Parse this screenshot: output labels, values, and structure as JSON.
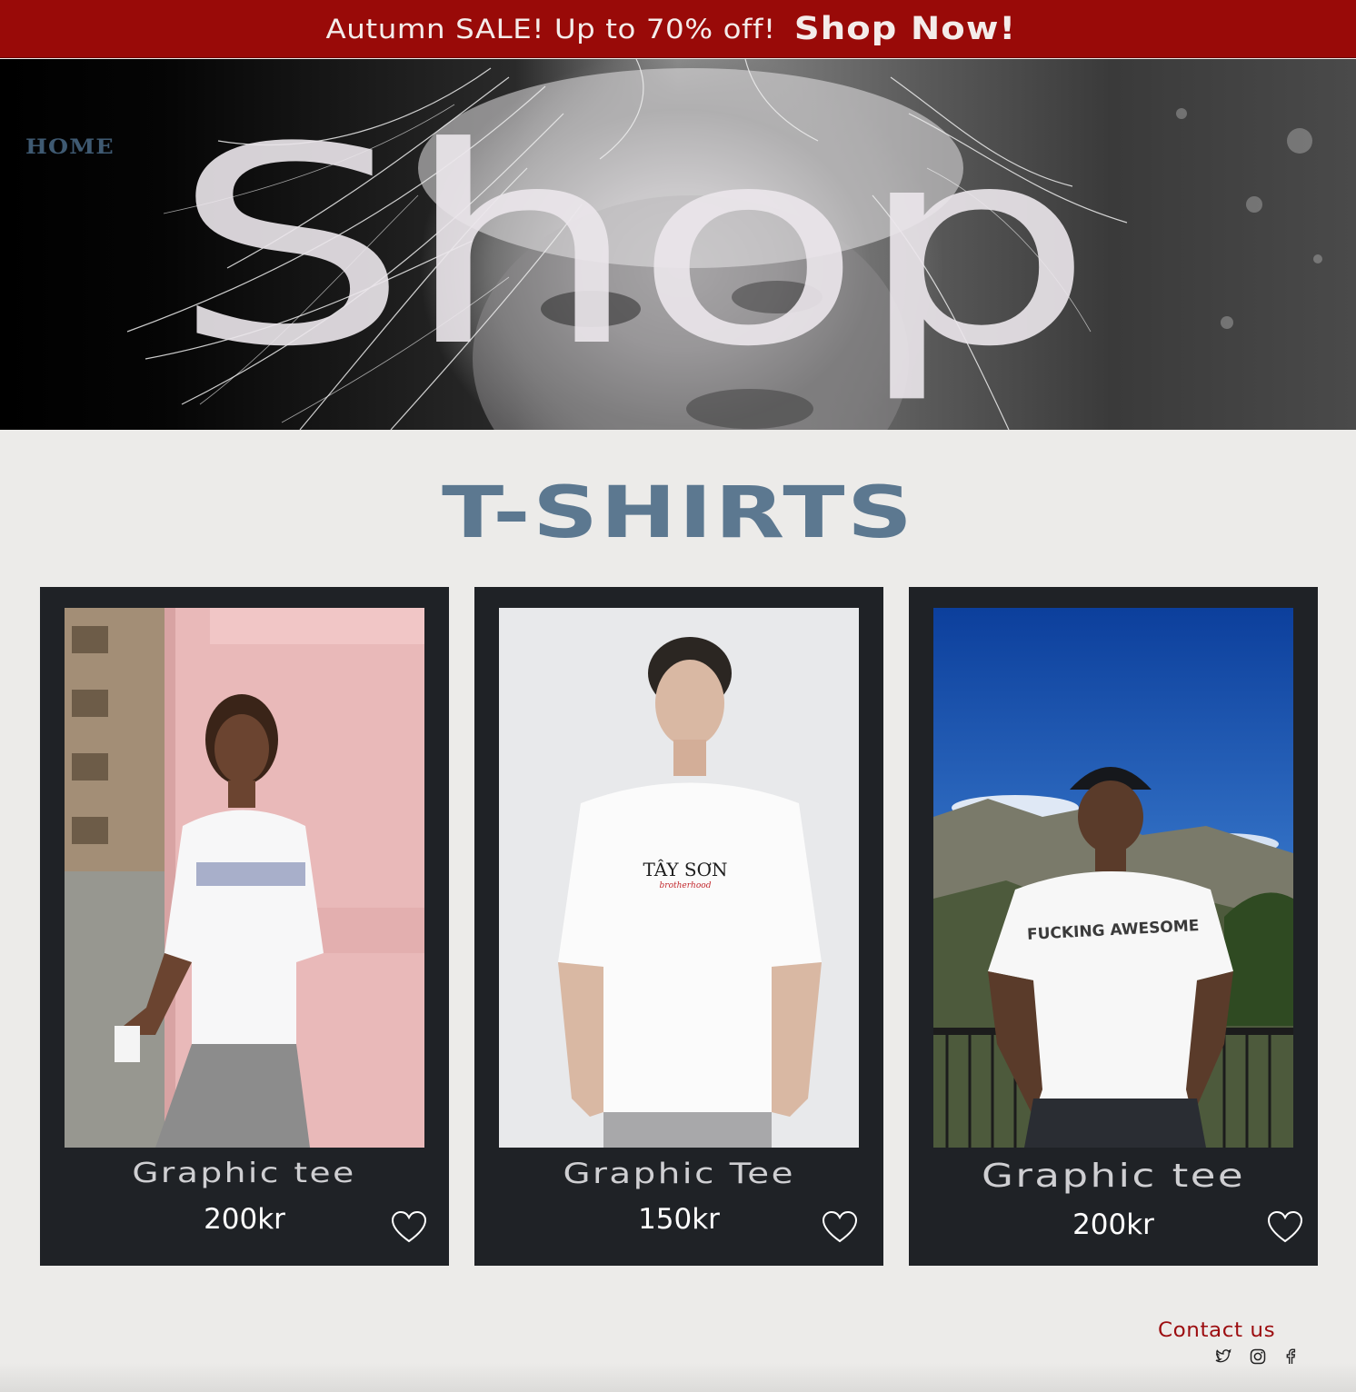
{
  "banner": {
    "sale_text": "Autumn SALE! Up to 70% off!",
    "cta_label": "Shop Now!",
    "background_color": "#990a08"
  },
  "hero": {
    "word": "Shop",
    "home_label": "HOME"
  },
  "section": {
    "title": "T-SHIRTS",
    "title_color": "#5c7890"
  },
  "products": [
    {
      "name": "Graphic tee",
      "price": "200kr",
      "favorite_icon": "heart-icon"
    },
    {
      "name": "Graphic Tee",
      "price": "150kr",
      "favorite_icon": "heart-icon"
    },
    {
      "name": "Graphic tee",
      "price": "200kr",
      "favorite_icon": "heart-icon"
    }
  ],
  "footer": {
    "contact_label": "Contact us",
    "contact_color": "#9c0d10",
    "social_icons": [
      "twitter-icon",
      "instagram-icon",
      "facebook-icon"
    ]
  }
}
